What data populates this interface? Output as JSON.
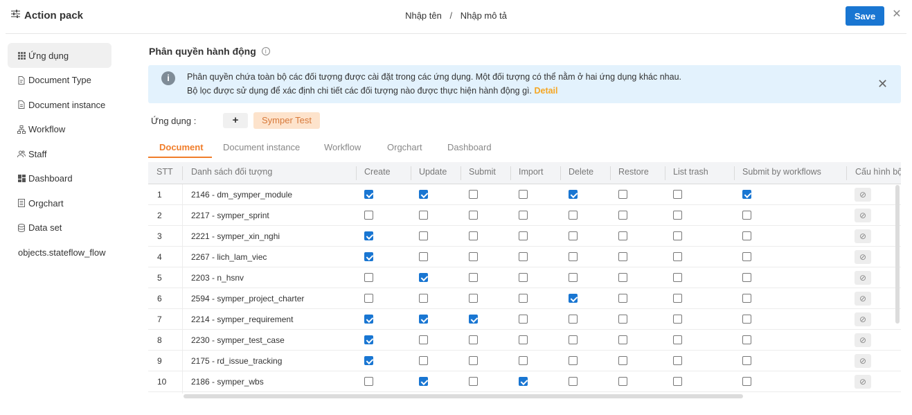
{
  "header": {
    "title": "Action pack",
    "name_placeholder": "Nhập tên",
    "separator": "/",
    "desc_placeholder": "Nhập mô tả",
    "save_label": "Save",
    "close_symbol": "✕"
  },
  "sidebar": {
    "items": [
      {
        "label": "Ứng dụng",
        "icon": "grid-icon",
        "active": true
      },
      {
        "label": "Document Type",
        "icon": "document-edit-icon"
      },
      {
        "label": "Document instance",
        "icon": "document-icon"
      },
      {
        "label": "Workflow",
        "icon": "workflow-icon"
      },
      {
        "label": "Staff",
        "icon": "users-icon"
      },
      {
        "label": "Dashboard",
        "icon": "dashboard-icon"
      },
      {
        "label": "Orgchart",
        "icon": "orgchart-icon"
      },
      {
        "label": "Data set",
        "icon": "database-icon"
      },
      {
        "label": "objects.stateflow_flow",
        "icon": ""
      }
    ]
  },
  "main": {
    "title": "Phân quyền hành động",
    "info_symbol": "i",
    "alert": {
      "icon_symbol": "i",
      "line1": "Phân quyền chứa toàn bộ các đối tượng được cài đặt trong các ứng dụng. Một đối tượng có thể nằm ở hai ứng dụng khác nhau.",
      "line2": "Bộ lọc được sử dụng để xác định chi tiết các đối tượng nào được thực hiện hành động gì.",
      "detail_link": "Detail",
      "close_symbol": "✕"
    },
    "app_label": "Ứng dụng :",
    "add_symbol": "+",
    "selected_app": "Symper Test",
    "tabs": [
      "Document",
      "Document instance",
      "Workflow",
      "Orgchart",
      "Dashboard"
    ],
    "active_tab": 0
  },
  "table": {
    "columns": [
      "STT",
      "Danh sách đối tượng",
      "Create",
      "Update",
      "Submit",
      "Import",
      "Delete",
      "Restore",
      "List trash",
      "Submit by workflows",
      "Cấu hình bộ"
    ],
    "config_symbol": "⊘",
    "rows": [
      {
        "stt": "1",
        "name": "2146 - dm_symper_module",
        "checks": [
          true,
          true,
          false,
          false,
          true,
          false,
          false,
          true
        ]
      },
      {
        "stt": "2",
        "name": "2217 - symper_sprint",
        "checks": [
          false,
          false,
          false,
          false,
          false,
          false,
          false,
          false
        ]
      },
      {
        "stt": "3",
        "name": "2221 - symper_xin_nghi",
        "checks": [
          true,
          false,
          false,
          false,
          false,
          false,
          false,
          false
        ]
      },
      {
        "stt": "4",
        "name": "2267 - lich_lam_viec",
        "checks": [
          true,
          false,
          false,
          false,
          false,
          false,
          false,
          false
        ]
      },
      {
        "stt": "5",
        "name": "2203 - n_hsnv",
        "checks": [
          false,
          true,
          false,
          false,
          false,
          false,
          false,
          false
        ]
      },
      {
        "stt": "6",
        "name": "2594 - symper_project_charter",
        "checks": [
          false,
          false,
          false,
          false,
          true,
          false,
          false,
          false
        ]
      },
      {
        "stt": "7",
        "name": "2214 - symper_requirement",
        "checks": [
          true,
          true,
          true,
          false,
          false,
          false,
          false,
          false
        ]
      },
      {
        "stt": "8",
        "name": "2230 - symper_test_case",
        "checks": [
          true,
          false,
          false,
          false,
          false,
          false,
          false,
          false
        ]
      },
      {
        "stt": "9",
        "name": "2175 - rd_issue_tracking",
        "checks": [
          true,
          false,
          false,
          false,
          false,
          false,
          false,
          false
        ]
      },
      {
        "stt": "10",
        "name": "2186 - symper_wbs",
        "checks": [
          false,
          true,
          false,
          true,
          false,
          false,
          false,
          false
        ]
      }
    ]
  },
  "colors": {
    "primary": "#1976d2",
    "accent": "#f07d2a",
    "alert_bg": "#e3f2fd",
    "chip_bg": "#fde3cc"
  }
}
